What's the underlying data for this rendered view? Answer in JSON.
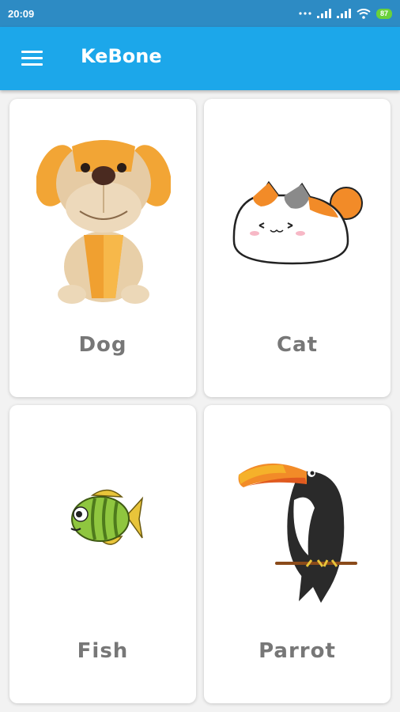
{
  "status_bar": {
    "time": "20:09",
    "battery": "87"
  },
  "app_bar": {
    "title": "KeBone"
  },
  "cards": [
    {
      "label": "Dog"
    },
    {
      "label": "Cat"
    },
    {
      "label": "Fish"
    },
    {
      "label": "Parrot"
    }
  ],
  "colors": {
    "status_bar": "#2d8bc4",
    "app_bar": "#1ca7ea",
    "label_text": "#777777",
    "battery": "#6ad13a"
  }
}
